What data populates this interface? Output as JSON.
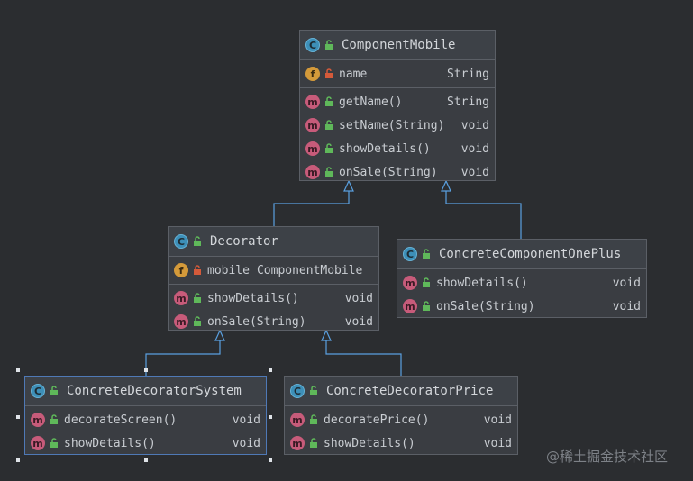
{
  "classes": {
    "component_mobile": {
      "name": "ComponentMobile",
      "fields": [
        {
          "name": "name",
          "type": "String"
        }
      ],
      "methods": [
        {
          "name": "getName()",
          "type": "String"
        },
        {
          "name": "setName(String)",
          "type": "void"
        },
        {
          "name": "showDetails()",
          "type": "void"
        },
        {
          "name": "onSale(String)",
          "type": "void"
        }
      ]
    },
    "decorator": {
      "name": "Decorator",
      "fields": [
        {
          "name": "mobile",
          "type": "ComponentMobile"
        }
      ],
      "methods": [
        {
          "name": "showDetails()",
          "type": "void"
        },
        {
          "name": "onSale(String)",
          "type": "void"
        }
      ]
    },
    "concrete_component_oneplus": {
      "name": "ConcreteComponentOnePlus",
      "methods": [
        {
          "name": "showDetails()",
          "type": "void"
        },
        {
          "name": "onSale(String)",
          "type": "void"
        }
      ]
    },
    "concrete_decorator_system": {
      "name": "ConcreteDecoratorSystem",
      "methods": [
        {
          "name": "decorateScreen()",
          "type": "void"
        },
        {
          "name": "showDetails()",
          "type": "void"
        }
      ]
    },
    "concrete_decorator_price": {
      "name": "ConcreteDecoratorPrice",
      "methods": [
        {
          "name": "decoratePrice()",
          "type": "void"
        },
        {
          "name": "showDetails()",
          "type": "void"
        }
      ]
    }
  },
  "icons": {
    "class": "C",
    "method": "m",
    "field": "f"
  },
  "watermark": "@稀土掘金技术社区"
}
